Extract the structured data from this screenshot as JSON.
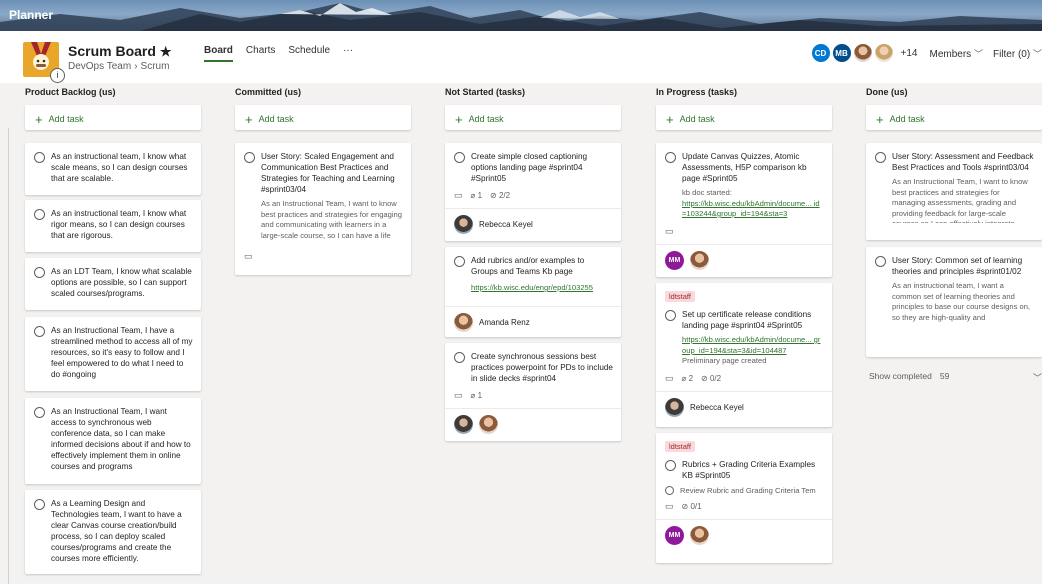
{
  "app": {
    "name": "Planner"
  },
  "board": {
    "title": "Scrum Board",
    "star": "★",
    "team": "DevOps Team",
    "sep": "›",
    "plan": "Scrum"
  },
  "nav": {
    "tabs": [
      "Board",
      "Charts",
      "Schedule"
    ],
    "more": "···"
  },
  "header_right": {
    "avatar1": "CD",
    "avatar1_color": "#0078d4",
    "avatar2": "MB",
    "avatar2_color": "#004e8c",
    "extra_count": "+14",
    "members": "Members",
    "filter": "Filter (0)",
    "chevron": "﹀"
  },
  "columns": [
    {
      "title": "Product Backlog (us)",
      "add": "Add task"
    },
    {
      "title": "Committed (us)",
      "add": "Add task"
    },
    {
      "title": "Not Started (tasks)",
      "add": "Add task"
    },
    {
      "title": "In Progress (tasks)",
      "add": "Add task"
    },
    {
      "title": "Done (us)",
      "add": "Add task"
    }
  ],
  "backlog": [
    "As an instructional team, I know what scale means, so I can design courses that are scalable.",
    "As an instructional team, I know what rigor means, so I can design courses that are rigorous.",
    "As an LDT Team, I know what scalable options are possible, so I can support scaled courses/programs.",
    "As an Instructional Team, I have a streamlined method to access all of my resources, so it's easy to follow and I feel empowered to do what I need to do #ongoing",
    "As an Instructional Team, I want access to synchronous web conference data, so I can make informed decisions about if and how to effectively implement them in online courses and programs",
    "As a Learning Design and Technologies team, I want to have a clear Canvas course creation/build process, so I can deploy scaled courses/programs and create the courses more efficiently."
  ],
  "committed": {
    "title": "User Story: Scaled Engagement and Communication Best Practices and Strategies for Teaching and Learning #sprint03/04",
    "desc": "As an Instructional Team, I want to know best practices and strategies for engaging and communicating with learners in a large-scale course, so I can have a life"
  },
  "notstarted": [
    {
      "title": "Create simple closed captioning options landing page #sprint04 #Sprint05",
      "attach": "1",
      "check": "2/2",
      "assignee": "Rebecca Keyel"
    },
    {
      "title": "Add rubrics and/or examples to Groups and Teams Kb page",
      "link": "https://kb.wisc.edu/engr/epd/103255",
      "assignee": "Amanda Renz"
    },
    {
      "title": "Create synchronous sessions best practices powerpoint for PDs to include in slide decks #sprint04",
      "attach": "1"
    }
  ],
  "inprogress": [
    {
      "title": "Update Canvas Quizzes, Atomic Assessments, H5P comparison kb page #Sprint05",
      "note": "kb doc started:",
      "link": "https://kb.wisc.edu/kbAdmin/docume... id=103244&group_id=194&sta=3",
      "avatar": "MM"
    },
    {
      "label": "ldtstaff",
      "title": "Set up certificate release conditions landing page #sprint04 #Sprint05",
      "link": "https://kb.wisc.edu/kbAdmin/docume... group_id=194&sta=3&id=104487",
      "note": "Preliminary page created",
      "attach": "2",
      "check": "0/2",
      "assignee": "Rebecca Keyel"
    },
    {
      "label": "ldtstaff",
      "title": "Rubrics + Grading Criteria Examples KB #Sprint05",
      "subtask": "Review Rubric and Grading Criteria Tem",
      "check": "0/1",
      "avatar": "MM"
    }
  ],
  "done": [
    {
      "title": "User Story: Assessment and Feedback Best Practices and Tools #sprint03/04",
      "desc": "As an Instructional Team, I want to know best practices and strategies for managing assessments, grading and providing feedback for large-scale courses so I can effectively integrate"
    },
    {
      "title": "User Story: Common set of learning theories and principles #sprint01/02",
      "desc": "As an instructional team, I want a common set of learning theories and principles to base our course designs on, so they are high-quality and"
    }
  ],
  "show_completed": {
    "label": "Show completed",
    "count": "59"
  },
  "colors": {
    "accent": "#31752f",
    "label_bg": "#f9d9dc",
    "label_fg": "#a4262c",
    "mm_avatar": "#8e1a9a"
  }
}
